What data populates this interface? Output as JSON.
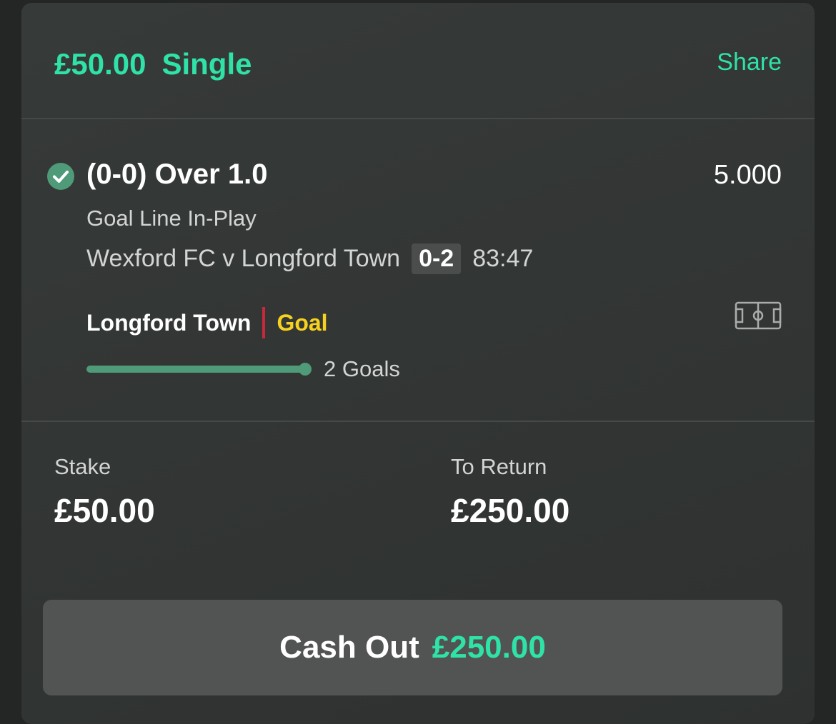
{
  "header": {
    "stake_amount": "£50.00",
    "bet_type": "Single",
    "share_label": "Share"
  },
  "selection": {
    "status_icon": "check-circle-icon",
    "name": "(0-0) Over 1.0",
    "odds": "5.000",
    "market": "Goal Line In-Play",
    "event": "Wexford FC v Longford Town",
    "score": "0-2",
    "clock": "83:47",
    "last_event_team": "Longford Town",
    "last_event_type": "Goal",
    "match_tracker_icon": "pitch-icon",
    "progress_fraction": 1.0,
    "progress_label": "2 Goals"
  },
  "summary": {
    "stake_label": "Stake",
    "stake_value": "£50.00",
    "return_label": "To Return",
    "return_value": "£250.00"
  },
  "cashout": {
    "label": "Cash Out",
    "value": "£250.00"
  },
  "colors": {
    "accent": "#2fe2a8",
    "success": "#4f9a78",
    "goal": "#f6d21e",
    "divider": "#c8283c"
  }
}
